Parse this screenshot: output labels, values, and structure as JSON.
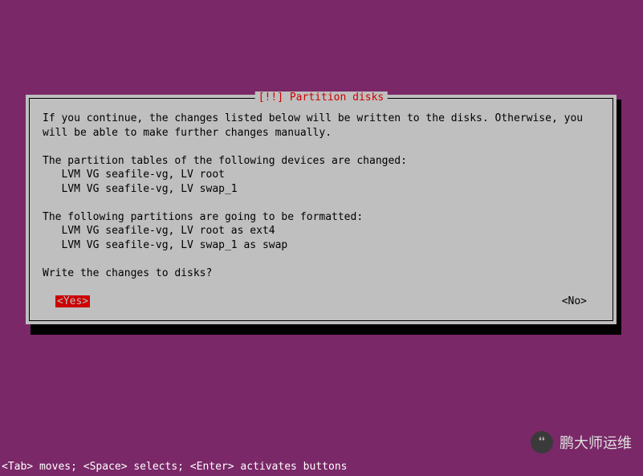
{
  "dialog": {
    "title": "[!!] Partition disks",
    "para1": "If you continue, the changes listed below will be written to the disks. Otherwise, you will be able to make further changes manually.",
    "para2_header": "The partition tables of the following devices are changed:",
    "para2_line1": "   LVM VG seafile-vg, LV root",
    "para2_line2": "   LVM VG seafile-vg, LV swap_1",
    "para3_header": "The following partitions are going to be formatted:",
    "para3_line1": "   LVM VG seafile-vg, LV root as ext4",
    "para3_line2": "   LVM VG seafile-vg, LV swap_1 as swap",
    "prompt": "Write the changes to disks?",
    "yes": "<Yes>",
    "no": "<No>"
  },
  "help": "<Tab> moves; <Space> selects; <Enter> activates buttons",
  "watermark": {
    "text": "鹏大师运维"
  }
}
